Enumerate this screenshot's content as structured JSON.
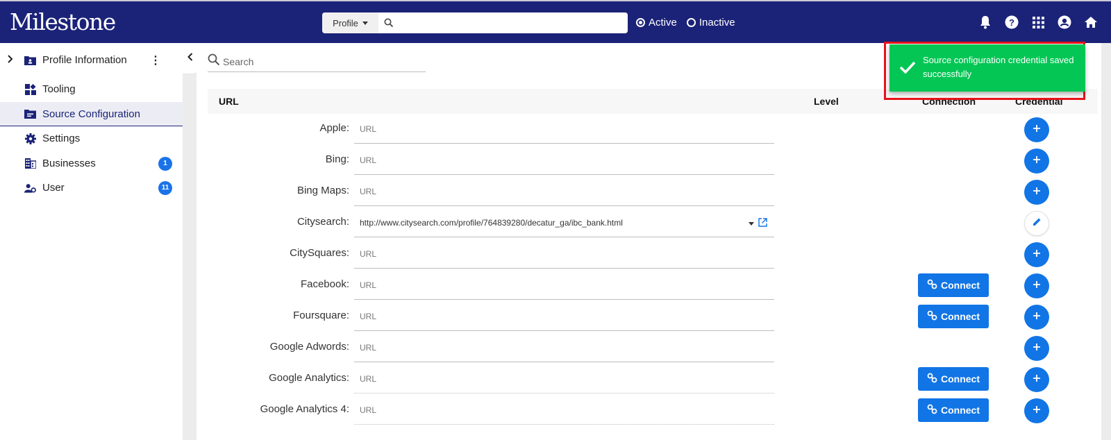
{
  "header": {
    "logo": "Milestone",
    "search_scope": "Profile",
    "search_placeholder": "",
    "status_options": [
      {
        "label": "Active",
        "selected": true
      },
      {
        "label": "Inactive",
        "selected": false
      }
    ],
    "icons": [
      "bell-icon",
      "help-icon",
      "apps-grid-icon",
      "account-icon",
      "home-icon"
    ]
  },
  "sidebar": {
    "items": [
      {
        "label": "Profile Information",
        "icon": "profile-card-icon"
      },
      {
        "label": "Tooling",
        "icon": "tooling-icon"
      },
      {
        "label": "Source Configuration",
        "icon": "source-config-icon",
        "active": true
      },
      {
        "label": "Settings",
        "icon": "gear-icon"
      },
      {
        "label": "Businesses",
        "icon": "building-icon",
        "badge": "1"
      },
      {
        "label": "User",
        "icon": "user-settings-icon",
        "badge": "11"
      }
    ]
  },
  "content": {
    "search_placeholder": "Search",
    "columns": {
      "url": "URL",
      "level": "Level",
      "connection": "Connection",
      "credential": "Credential"
    },
    "url_placeholder": "URL",
    "connect_label": "Connect",
    "rows": [
      {
        "name": "Apple:",
        "url": "",
        "connect": false,
        "credential": "add"
      },
      {
        "name": "Bing:",
        "url": "",
        "connect": false,
        "credential": "add"
      },
      {
        "name": "Bing Maps:",
        "url": "",
        "connect": false,
        "credential": "add"
      },
      {
        "name": "Citysearch:",
        "url": "http://www.citysearch.com/profile/764839280/decatur_ga/ibc_bank.html",
        "connect": false,
        "credential": "edit"
      },
      {
        "name": "CitySquares:",
        "url": "",
        "connect": false,
        "credential": "add"
      },
      {
        "name": "Facebook:",
        "url": "",
        "connect": true,
        "credential": "add"
      },
      {
        "name": "Foursquare:",
        "url": "",
        "connect": true,
        "credential": "add"
      },
      {
        "name": "Google Adwords:",
        "url": "",
        "connect": false,
        "credential": "add"
      },
      {
        "name": "Google Analytics:",
        "url": "",
        "connect": true,
        "credential": "add",
        "dotted": true
      },
      {
        "name": "Google Analytics 4:",
        "url": "",
        "connect": true,
        "credential": "add",
        "dotted": true
      }
    ]
  },
  "toast": {
    "message": "Source configuration credential saved successfully",
    "status": "success",
    "color": "#04c654"
  },
  "colors": {
    "header": "#1b2378",
    "accent": "#1175e6",
    "highlight_outline": "#e8131a"
  }
}
